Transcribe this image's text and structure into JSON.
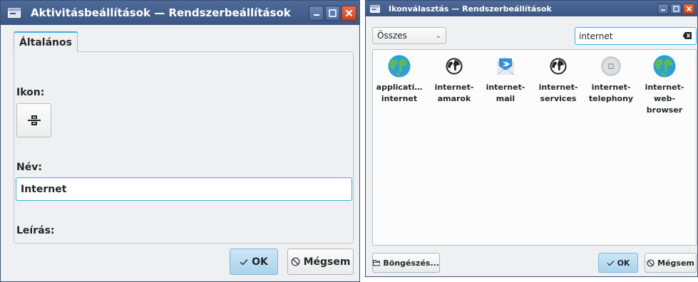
{
  "activity_window": {
    "title": "Aktivitásbeállítások — Rendszerbeállítások",
    "tab_label": "Általános",
    "icon_label": "Ikon:",
    "name_label": "Név:",
    "name_value": "Internet",
    "desc_label": "Leírás:",
    "ok_label": "OK",
    "cancel_label": "Mégsem",
    "ok_icon": "checkmark-icon",
    "cancel_icon": "cancel-circle-icon",
    "selected_icon": "activities-icon"
  },
  "icon_window": {
    "title": "Ikonválasztás — Rendszerbeállítások",
    "category": "Összes",
    "search_value": "internet",
    "browse_label": "Böngészés...",
    "ok_label": "OK",
    "cancel_label": "Mégsem",
    "icons": [
      {
        "label": "applicati…\ninternet",
        "icon": "globe-color-icon"
      },
      {
        "label": "internet-\namarok",
        "icon": "globe-black-icon"
      },
      {
        "label": "internet-\nmail",
        "icon": "mail-icon"
      },
      {
        "label": "internet-\nservices",
        "icon": "globe-black-icon"
      },
      {
        "label": "internet-\ntelephony",
        "icon": "telephony-icon"
      },
      {
        "label": "internet-\nweb-\nbrowser",
        "icon": "globe-color-icon"
      }
    ]
  },
  "colors": {
    "titlebar": "#3b5683",
    "accent": "#3daee9",
    "close": "#d9532c",
    "window_bg": "#eff0f1"
  }
}
